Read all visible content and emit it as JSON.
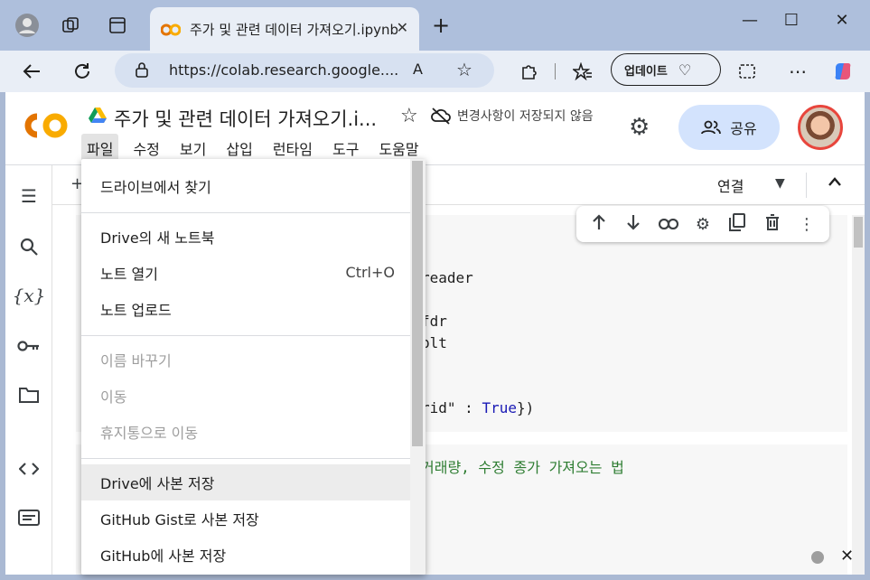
{
  "browser": {
    "tab_title": "주가 및 관련 데이터 가져오기.ipynb",
    "tab_close": "✕",
    "new_tab": "+",
    "url": "https://colab.research.google....",
    "update_label": "업데이트"
  },
  "colab": {
    "doc_title": "주가 및 관련 데이터 가져오기.i...",
    "unsaved_status": "변경사항이 저장되지 않음",
    "share_label": "공유",
    "menubar": [
      "파일",
      "수정",
      "보기",
      "삽입",
      "런타임",
      "도구",
      "도움말"
    ],
    "connect_label": "연결",
    "add_symbol": "+"
  },
  "code_fragments": {
    "line1": "reader",
    "line2": "fdr",
    "line3": "plt",
    "line4_pre": "rid\" : ",
    "line4_kw": "True",
    "line4_post": "})",
    "comment": "거래량, 수정 종가 가져오는 법"
  },
  "file_menu": {
    "items": [
      {
        "label": "드라이브에서 찾기",
        "disabled": false
      },
      {
        "label": "Drive의 새 노트북",
        "disabled": false
      },
      {
        "label": "노트 열기",
        "shortcut": "Ctrl+O",
        "disabled": false
      },
      {
        "label": "노트 업로드",
        "disabled": false
      },
      {
        "label": "이름 바꾸기",
        "disabled": true
      },
      {
        "label": "이동",
        "disabled": true
      },
      {
        "label": "휴지통으로 이동",
        "disabled": true
      },
      {
        "label": "Drive에 사본 저장",
        "disabled": false,
        "highlighted": true
      },
      {
        "label": "GitHub Gist로 사본 저장",
        "disabled": false
      },
      {
        "label": "GitHub에 사본 저장",
        "disabled": false
      }
    ]
  },
  "colors": {
    "accent": "#d3e3fd",
    "keyword": "#1a1ab5",
    "comment": "#2e7d32",
    "colab_orange": "#f9ab00",
    "colab_dark_orange": "#e37400"
  }
}
